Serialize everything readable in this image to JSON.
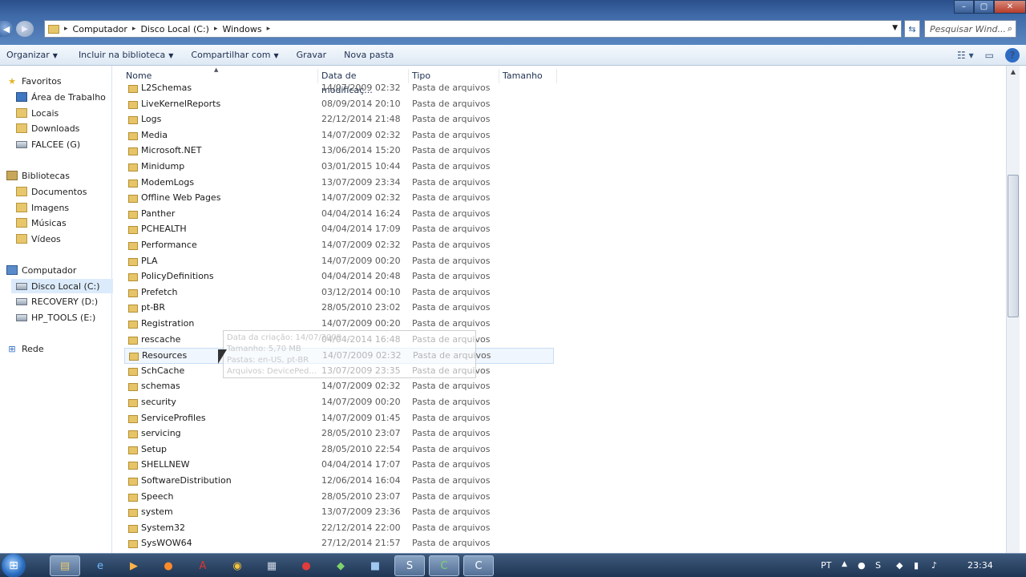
{
  "window": {
    "controls": [
      "–",
      "▢",
      "✕"
    ]
  },
  "address": {
    "crumbs": [
      "Computador",
      "Disco Local (C:)",
      "Windows"
    ]
  },
  "search": {
    "placeholder": "Pesquisar Wind..."
  },
  "toolbar": {
    "organize": "Organizar",
    "include_library": "Incluir na biblioteca",
    "share": "Compartilhar com",
    "burn": "Gravar",
    "new_folder": "Nova pasta"
  },
  "navpane": {
    "favorites": {
      "label": "Favoritos",
      "items": [
        "Área de Trabalho",
        "Locais",
        "Downloads",
        "FALCEE (G)"
      ]
    },
    "libraries": {
      "label": "Bibliotecas",
      "items": [
        "Documentos",
        "Imagens",
        "Músicas",
        "Vídeos"
      ]
    },
    "computer": {
      "label": "Computador",
      "items": [
        "Disco Local (C:)",
        "RECOVERY (D:)",
        "HP_TOOLS (E:)"
      ]
    },
    "network": {
      "label": "Rede"
    }
  },
  "columns": {
    "name": "Nome",
    "date": "Data de modificaç...",
    "type": "Tipo",
    "size": "Tamanho"
  },
  "files": [
    {
      "name": "L2Schemas",
      "date": "14/07/2009 02:32",
      "type": "Pasta de arquivos"
    },
    {
      "name": "LiveKernelReports",
      "date": "08/09/2014 20:10",
      "type": "Pasta de arquivos"
    },
    {
      "name": "Logs",
      "date": "22/12/2014 21:48",
      "type": "Pasta de arquivos"
    },
    {
      "name": "Media",
      "date": "14/07/2009 02:32",
      "type": "Pasta de arquivos"
    },
    {
      "name": "Microsoft.NET",
      "date": "13/06/2014 15:20",
      "type": "Pasta de arquivos"
    },
    {
      "name": "Minidump",
      "date": "03/01/2015 10:44",
      "type": "Pasta de arquivos"
    },
    {
      "name": "ModemLogs",
      "date": "13/07/2009 23:34",
      "type": "Pasta de arquivos"
    },
    {
      "name": "Offline Web Pages",
      "date": "14/07/2009 02:32",
      "type": "Pasta de arquivos"
    },
    {
      "name": "Panther",
      "date": "04/04/2014 16:24",
      "type": "Pasta de arquivos"
    },
    {
      "name": "PCHEALTH",
      "date": "04/04/2014 17:09",
      "type": "Pasta de arquivos"
    },
    {
      "name": "Performance",
      "date": "14/07/2009 02:32",
      "type": "Pasta de arquivos"
    },
    {
      "name": "PLA",
      "date": "14/07/2009 00:20",
      "type": "Pasta de arquivos"
    },
    {
      "name": "PolicyDefinitions",
      "date": "04/04/2014 20:48",
      "type": "Pasta de arquivos"
    },
    {
      "name": "Prefetch",
      "date": "03/12/2014 00:10",
      "type": "Pasta de arquivos"
    },
    {
      "name": "pt-BR",
      "date": "28/05/2010 23:02",
      "type": "Pasta de arquivos"
    },
    {
      "name": "Registration",
      "date": "14/07/2009 00:20",
      "type": "Pasta de arquivos"
    },
    {
      "name": "rescache",
      "date": "04/04/2014 16:48",
      "type": "Pasta de arquivos"
    },
    {
      "name": "Resources",
      "date": "14/07/2009 02:32",
      "type": "Pasta de arquivos",
      "hover": true
    },
    {
      "name": "SchCache",
      "date": "13/07/2009 23:35",
      "type": "Pasta de arquivos"
    },
    {
      "name": "schemas",
      "date": "14/07/2009 02:32",
      "type": "Pasta de arquivos"
    },
    {
      "name": "security",
      "date": "14/07/2009 00:20",
      "type": "Pasta de arquivos"
    },
    {
      "name": "ServiceProfiles",
      "date": "14/07/2009 01:45",
      "type": "Pasta de arquivos"
    },
    {
      "name": "servicing",
      "date": "28/05/2010 23:07",
      "type": "Pasta de arquivos"
    },
    {
      "name": "Setup",
      "date": "28/05/2010 22:54",
      "type": "Pasta de arquivos"
    },
    {
      "name": "SHELLNEW",
      "date": "04/04/2014 17:07",
      "type": "Pasta de arquivos"
    },
    {
      "name": "SoftwareDistribution",
      "date": "12/06/2014 16:04",
      "type": "Pasta de arquivos"
    },
    {
      "name": "Speech",
      "date": "28/05/2010 23:07",
      "type": "Pasta de arquivos"
    },
    {
      "name": "system",
      "date": "13/07/2009 23:36",
      "type": "Pasta de arquivos"
    },
    {
      "name": "System32",
      "date": "22/12/2014 22:00",
      "type": "Pasta de arquivos"
    },
    {
      "name": "SysWOW64",
      "date": "27/12/2014 21:57",
      "type": "Pasta de arquivos"
    }
  ],
  "tooltip": {
    "lines": [
      "Data da criação: 14/07/2009 ...",
      "Tamanho: 5,70 MB",
      "Pastas: en-US, pt-BR",
      "Arquivos: DevicePed..."
    ]
  },
  "taskbar": {
    "language": "PT",
    "clock": "23:34"
  },
  "colors": {
    "folder": "#e6c467",
    "hover_row": "#f0f6fd",
    "titlebar": "#3f6aa8"
  }
}
